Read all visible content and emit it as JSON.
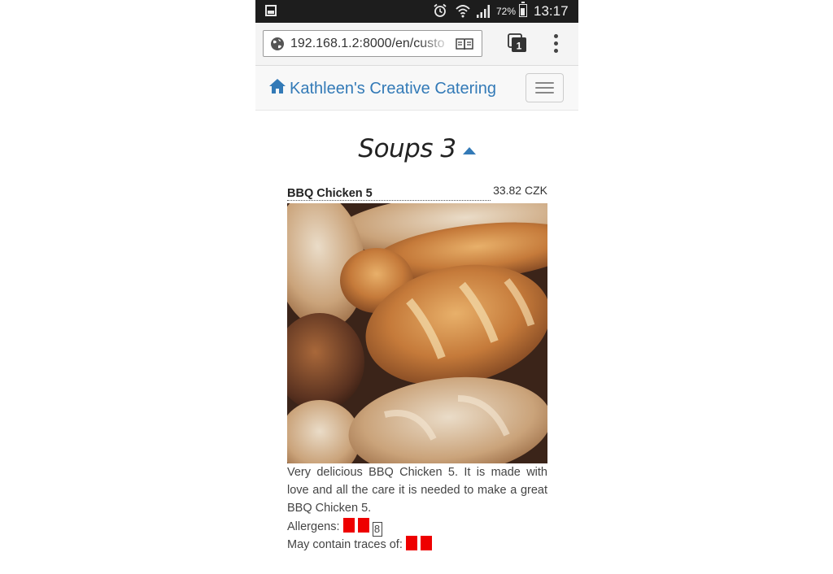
{
  "status_bar": {
    "battery": "72%",
    "time": "13:17"
  },
  "browser": {
    "url": "192.168.1.2:8000/en/custo",
    "tab_count": "1"
  },
  "navbar": {
    "brand": "Kathleen's Creative Catering"
  },
  "section": {
    "title": "Soups 3"
  },
  "item": {
    "name": "BBQ Chicken 5",
    "price": "33.82 CZK",
    "description": "Very delicious BBQ Chicken 5. It is made with love and all the care it is needed to make a great BBQ Chicken 5.",
    "allergens_label": "Allergens:",
    "allergen_number": "8",
    "traces_label": "May contain traces of:"
  },
  "colors": {
    "link_blue": "#337ab7",
    "allergen_red": "#ee0000",
    "status_bar_bg": "#1d1d1d"
  },
  "icons": [
    "gallery-icon",
    "alarm-icon",
    "wifi-icon",
    "signal-icon",
    "battery-icon",
    "globe-icon",
    "reader-mode-icon",
    "tabs-icon",
    "overflow-menu-icon",
    "home-icon",
    "hamburger-icon",
    "caret-up-icon"
  ]
}
